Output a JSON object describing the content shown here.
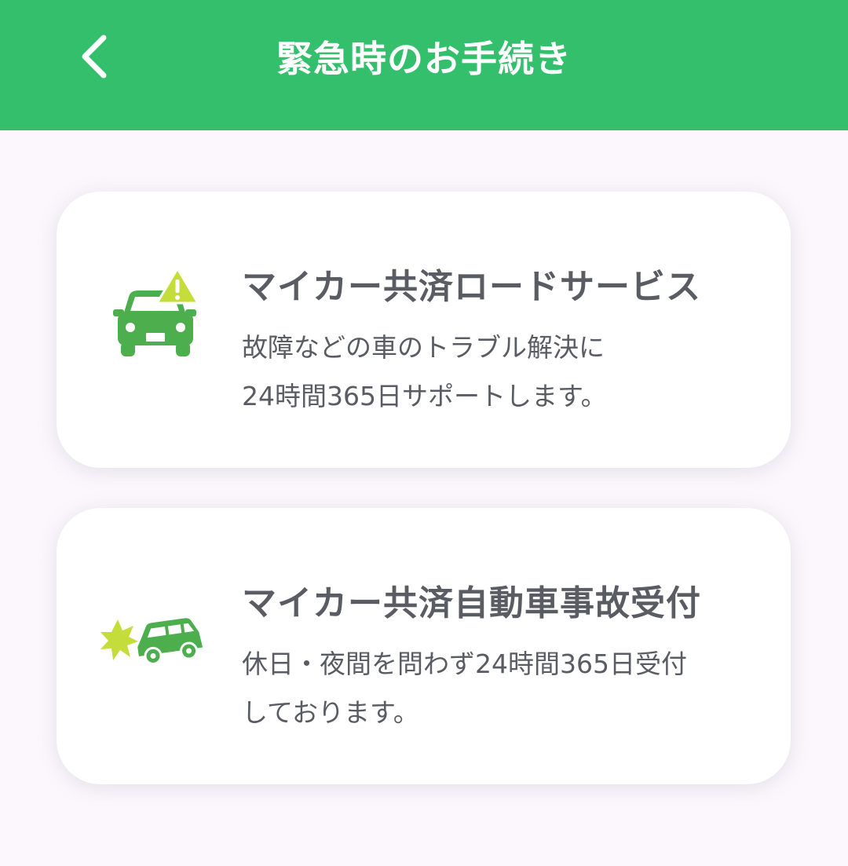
{
  "header": {
    "title": "緊急時のお手続き",
    "back_icon": "chevron-left-icon"
  },
  "cards": [
    {
      "icon": "car-warning-icon",
      "title": "マイカー共済ロードサービス",
      "desc_line1": "故障などの車のトラブル解決に",
      "desc_line2": "24時間365日サポートします。"
    },
    {
      "icon": "car-collision-icon",
      "title": "マイカー共済自動車事故受付",
      "desc_line1": "休日・夜間を問わず24時間365日受付",
      "desc_line2": "しております。"
    }
  ],
  "colors": {
    "header_bg": "#33bf6c",
    "page_bg": "#fbf7fd",
    "icon_green": "#4cae4c",
    "warning_yellow": "#c5dd3a",
    "text_gray": "#5a5c63"
  }
}
